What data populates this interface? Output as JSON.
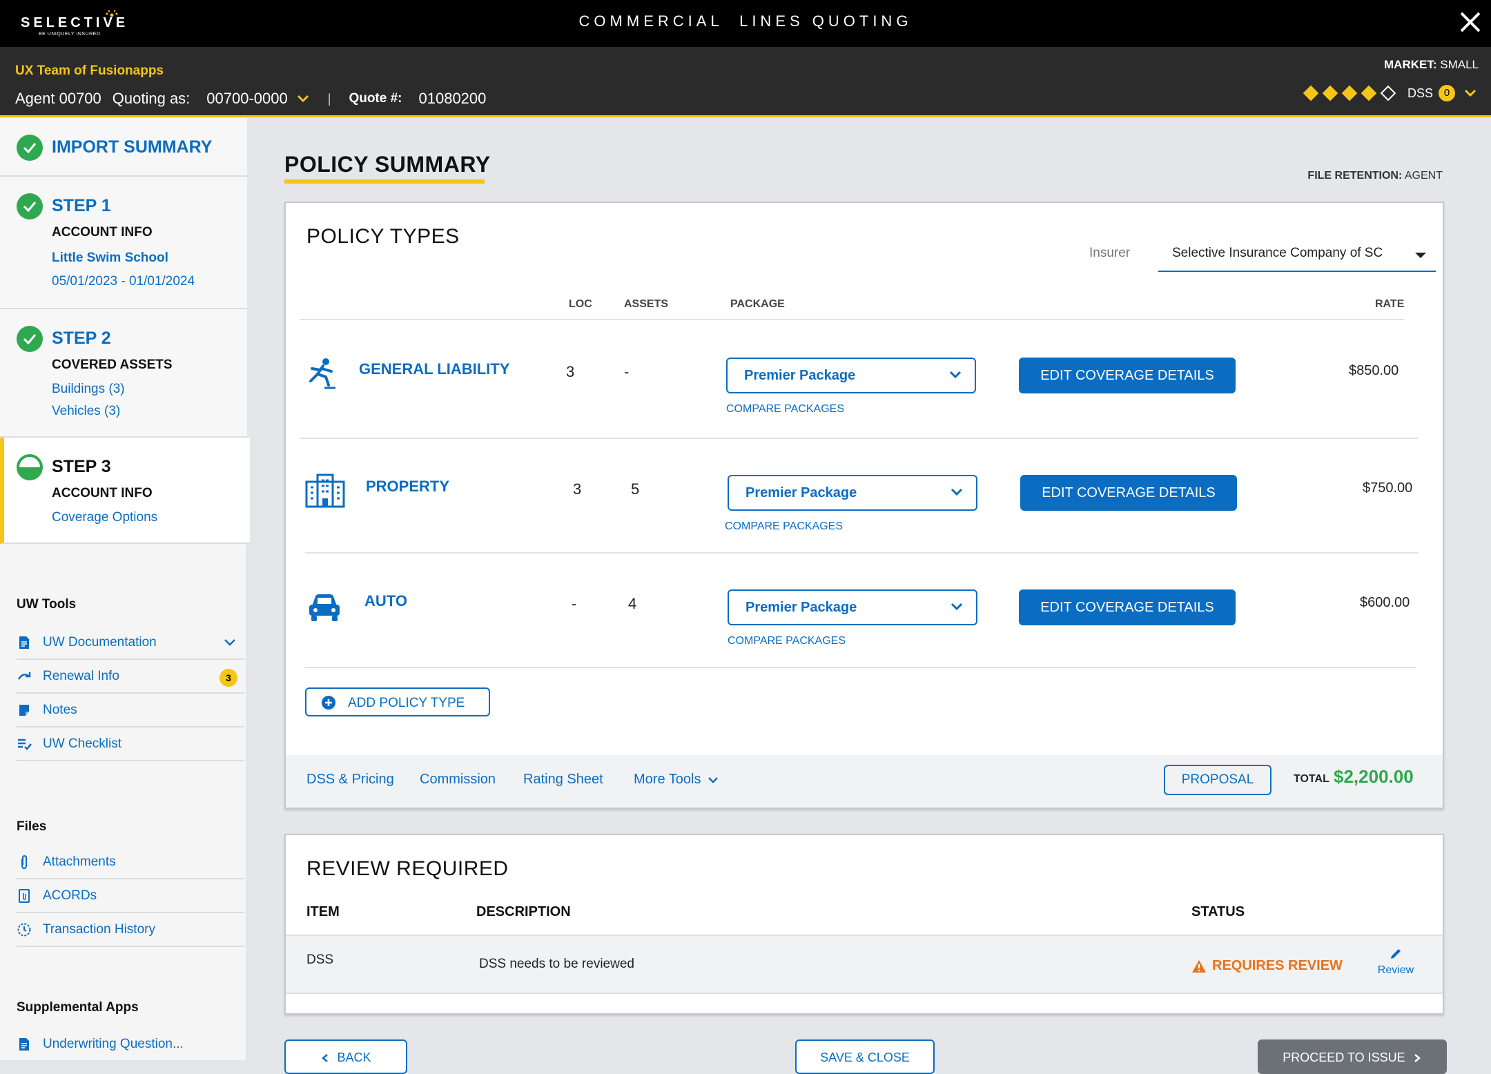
{
  "header": {
    "logo_text": "SELECTIVE",
    "logo_tagline": "BE UNIQUELY INSURED",
    "app_title": "COMMERCIAL  LINES QUOTING",
    "agency": "UX Team of Fusionapps",
    "agent": "Agent 00700",
    "quoting_as_label": "Quoting as:",
    "quoting_as_value": "00700-0000",
    "separator": "|",
    "quote_label": "Quote #:",
    "quote_value": "01080200",
    "market_label": "MARKET:",
    "market_value": "SMALL",
    "dss_label": "DSS",
    "dss_count": "0",
    "dss_rating": {
      "filled": 4,
      "total": 5
    }
  },
  "sidebar": {
    "import_summary": "IMPORT SUMMARY",
    "step1": {
      "title": "STEP 1",
      "subtitle": "ACCOUNT INFO",
      "name": "Little Swim School",
      "dates": "05/01/2023 - 01/01/2024"
    },
    "step2": {
      "title": "STEP 2",
      "subtitle": "COVERED ASSETS",
      "buildings": "Buildings (3)",
      "vehicles": "Vehicles (3)"
    },
    "step3": {
      "title": "STEP 3",
      "subtitle": "ACCOUNT INFO",
      "link": "Coverage Options"
    },
    "uw_tools": {
      "title": "UW Tools",
      "items": [
        {
          "label": "UW Documentation",
          "icon": "document-icon"
        },
        {
          "label": "Renewal Info",
          "icon": "renew-icon",
          "badge": "3"
        },
        {
          "label": "Notes",
          "icon": "note-icon"
        },
        {
          "label": "UW Checklist",
          "icon": "checklist-icon"
        }
      ]
    },
    "files": {
      "title": "Files",
      "items": [
        {
          "label": "Attachments",
          "icon": "paperclip-icon"
        },
        {
          "label": "ACORDs",
          "icon": "acord-icon"
        },
        {
          "label": "Transaction History",
          "icon": "history-icon"
        }
      ]
    },
    "supplemental": {
      "title": "Supplemental Apps",
      "items": [
        {
          "label": "Underwriting Question...",
          "icon": "document-icon"
        }
      ]
    }
  },
  "main": {
    "title": "POLICY SUMMARY",
    "retention_label": "FILE RETENTION:",
    "retention_value": "AGENT",
    "policy_types": {
      "title": "POLICY TYPES",
      "insurer_label": "Insurer",
      "insurer_value": "Selective Insurance Company of SC",
      "columns": {
        "loc": "LOC",
        "assets": "ASSETS",
        "package": "PACKAGE",
        "rate": "RATE"
      },
      "rows": [
        {
          "name": "GENERAL LIABILITY",
          "icon": "slip-fall-icon",
          "loc": "3",
          "assets": "-",
          "package": "Premier Package",
          "compare": "COMPARE PACKAGES",
          "edit": "EDIT COVERAGE DETAILS",
          "rate": "$850.00"
        },
        {
          "name": "PROPERTY",
          "icon": "building-icon",
          "loc": "3",
          "assets": "5",
          "package": "Premier Package",
          "compare": "COMPARE PACKAGES",
          "edit": "EDIT COVERAGE DETAILS",
          "rate": "$750.00"
        },
        {
          "name": "AUTO",
          "icon": "car-icon",
          "loc": "-",
          "assets": "4",
          "package": "Premier Package",
          "compare": "COMPARE PACKAGES",
          "edit": "EDIT COVERAGE DETAILS",
          "rate": "$600.00"
        }
      ],
      "add_label": "ADD POLICY TYPE",
      "footer": {
        "links": [
          "DSS & Pricing",
          "Commission",
          "Rating Sheet",
          "More Tools"
        ],
        "proposal": "PROPOSAL",
        "total_label": "TOTAL",
        "total_value": "$2,200.00"
      }
    },
    "review": {
      "title": "REVIEW REQUIRED",
      "columns": {
        "item": "ITEM",
        "description": "DESCRIPTION",
        "status": "STATUS"
      },
      "rows": [
        {
          "item": "DSS",
          "description": "DSS needs to be reviewed",
          "status": "REQUIRES REVIEW",
          "action": "Review"
        }
      ]
    },
    "buttons": {
      "back": "BACK",
      "save_close": "SAVE & CLOSE",
      "proceed": "PROCEED TO ISSUE"
    }
  },
  "colors": {
    "brand_blue": "#0a6dc2",
    "accent_yellow": "#f5c518",
    "success_green": "#2fa84f",
    "warning_orange": "#e8731a"
  }
}
